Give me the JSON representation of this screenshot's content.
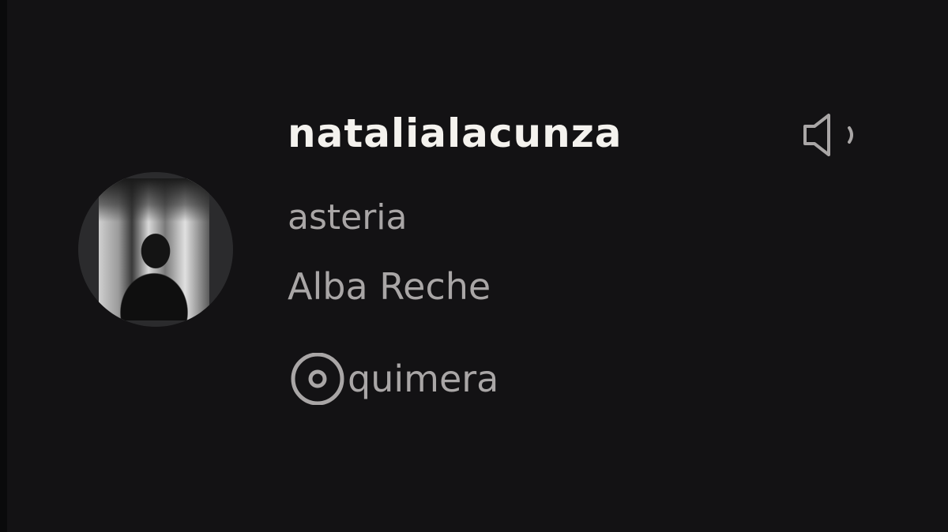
{
  "activity": {
    "username": "natalialacunza",
    "track_title": "asteria",
    "artist": "Alba Reche",
    "album": "quimera"
  },
  "icons": {
    "album": "disc-icon",
    "volume": "speaker-icon",
    "avatar": "user-avatar"
  },
  "colors": {
    "background": "#131214",
    "username": "#f4f2ee",
    "secondary_text": "#a9a6a6"
  }
}
